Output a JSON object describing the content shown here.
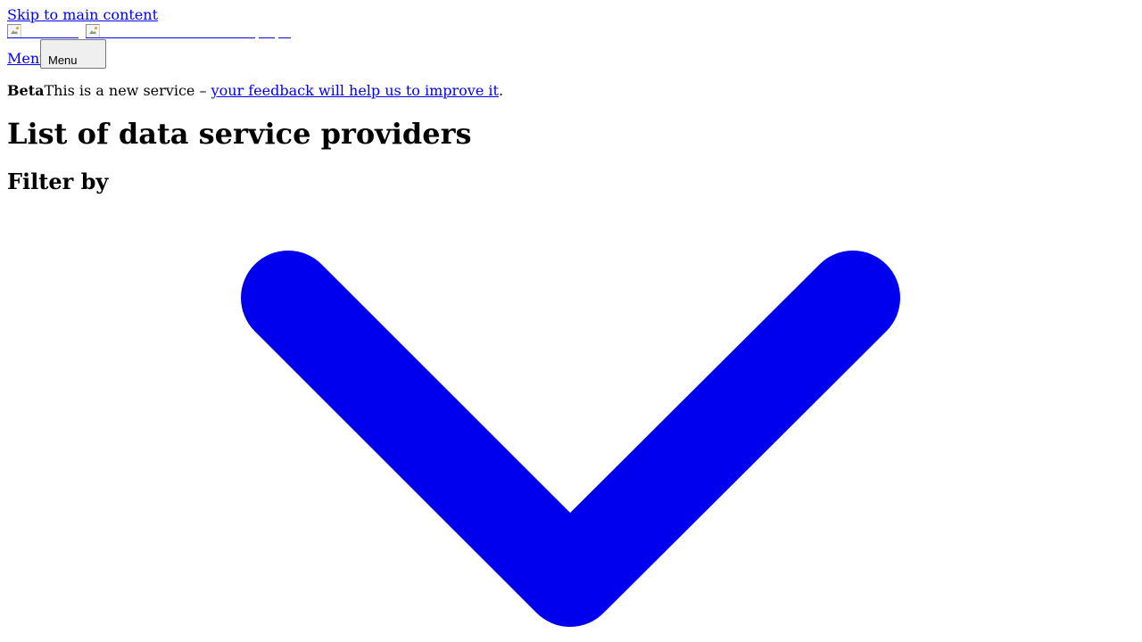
{
  "header": {
    "skip_link": "Skip to main content",
    "logos": [
      {
        "icon": "broken-image-icon"
      },
      {
        "icon": "broken-image-icon"
      }
    ],
    "menu_link": "Menu",
    "menu_button": "Menu"
  },
  "beta_banner": {
    "tag": "Beta",
    "text": "This is a new service – ",
    "link": "your feedback will help us to improve it",
    "suffix": "."
  },
  "main": {
    "title": "List of data service providers",
    "filter_heading": "Filter by",
    "filter_toggle_icon": "chevron-down-icon",
    "accent_color": "#0000ee"
  }
}
